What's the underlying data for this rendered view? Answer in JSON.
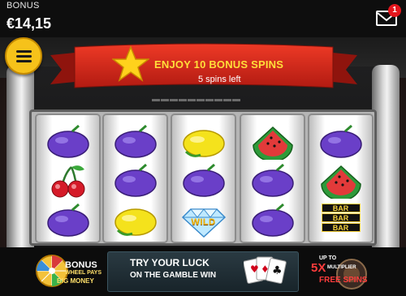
{
  "header": {
    "balance_label": "BONUS",
    "balance_value": "€14,15",
    "notification_count": "1"
  },
  "banner": {
    "title": "ENJOY 10 BONUS SPINS",
    "subtitle": "5 spins left"
  },
  "reels": [
    [
      "plum",
      "cherries",
      "plum"
    ],
    [
      "plum",
      "plum",
      "lemon"
    ],
    [
      "lemon",
      "plum",
      "wild-diamond"
    ],
    [
      "watermelon",
      "plum",
      "plum"
    ],
    [
      "plum",
      "watermelon",
      "bar-triple"
    ]
  ],
  "symbols": {
    "wild_label": "WILD",
    "bar_label": "BAR"
  },
  "bottom": {
    "bonus_wheel": {
      "line1": "BONUS",
      "line2": "WHEEL PAYS",
      "line3": "BIG MONEY"
    },
    "gamble": {
      "line1": "TRY YOUR LUCK",
      "line2": "ON THE GAMBLE WIN"
    },
    "multiplier": {
      "line1": "UP TO",
      "line2": "5X",
      "line3": "MULTIPLIER",
      "line4": "FREE SPINS"
    }
  },
  "colors": {
    "banner_red": "#d8281b",
    "banner_text": "#ffdf3a",
    "menu_yellow": "#f6c21a",
    "badge_red": "#e3161d"
  }
}
